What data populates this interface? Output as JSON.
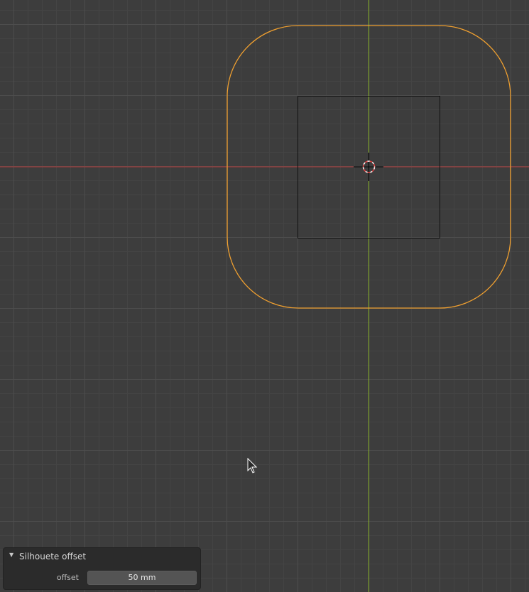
{
  "panel": {
    "title": "Silhouete offset",
    "offset_label": "offset",
    "offset_value": "50 mm"
  },
  "colors": {
    "background": "#3d3d3d",
    "grid_minor": "#444444",
    "grid_major": "#4d4d4d",
    "x_axis": "#b33b3b",
    "y_axis": "#8db82a",
    "silhouette": "#f0a030",
    "object_outline": "#111111"
  },
  "icons": {
    "panel_toggle": "triangle-down-icon",
    "cursor": "arrow-pointer-icon",
    "origin": "3d-cursor-icon"
  }
}
